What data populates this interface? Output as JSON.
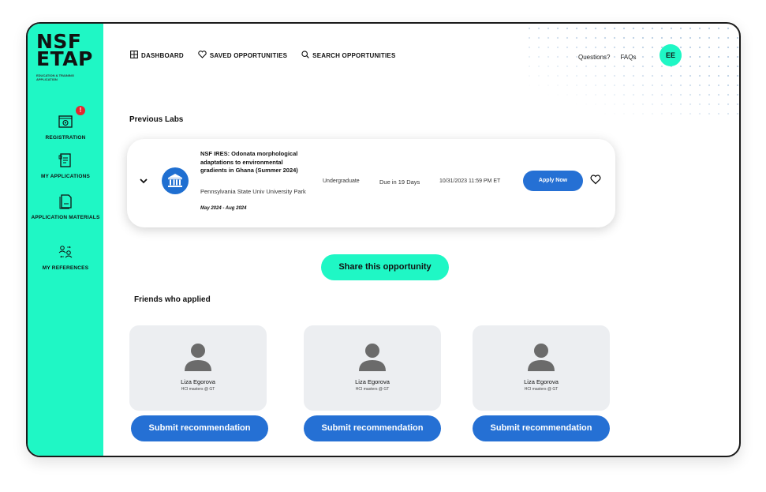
{
  "brand": {
    "logo_line1": "NSF",
    "logo_line2": "ETAP",
    "logo_sub": "EDUCATION & TRAINING APPLICATION"
  },
  "sidebar": {
    "items": [
      {
        "label": "REGISTRATION",
        "icon": "registration-icon",
        "badge": "!"
      },
      {
        "label": "MY APPLICATIONS",
        "icon": "applications-icon"
      },
      {
        "label": "APPLICATION MATERIALS",
        "icon": "materials-icon"
      },
      {
        "label": "MY REFERENCES",
        "icon": "references-icon"
      }
    ],
    "accent_color": "#1ff7c5"
  },
  "topnav": {
    "dashboard": "DASHBOARD",
    "saved": "SAVED OPPORTUNITIES",
    "search": "SEARCH OPPORTUNITIES"
  },
  "header": {
    "questions": "Questions?",
    "faqs": "FAQs",
    "avatar_initials": "EE"
  },
  "previous_labs": {
    "title": "Previous Labs",
    "lab": {
      "title": "NSF IRES: Odonata morphological adaptations to environmental gradients in Ghana (Summer 2024)",
      "university": "Pennsylvania State Univ University Park",
      "dates": "May 2024 - Aug 2024",
      "level": "Undergraduate",
      "due": "Due in 19 Days",
      "deadline": "10/31/2023 11:59 PM ET",
      "apply_label": "Apply Now"
    }
  },
  "share_label": "Share this opportunity",
  "friends": {
    "title": "Friends who applied",
    "items": [
      {
        "name": "Liza Egorova",
        "subtitle": "HCI masters @ GT",
        "button": "Submit recommendation"
      },
      {
        "name": "Liza Egorova",
        "subtitle": "HCI masters @ GT",
        "button": "Submit recommendation"
      },
      {
        "name": "Liza Egorova",
        "subtitle": "HCI masters @ GT",
        "button": "Submit recommendation"
      }
    ]
  },
  "colors": {
    "primary_blue": "#2570d4",
    "accent_green": "#1ff7c5",
    "alert_red": "#e3262f"
  }
}
